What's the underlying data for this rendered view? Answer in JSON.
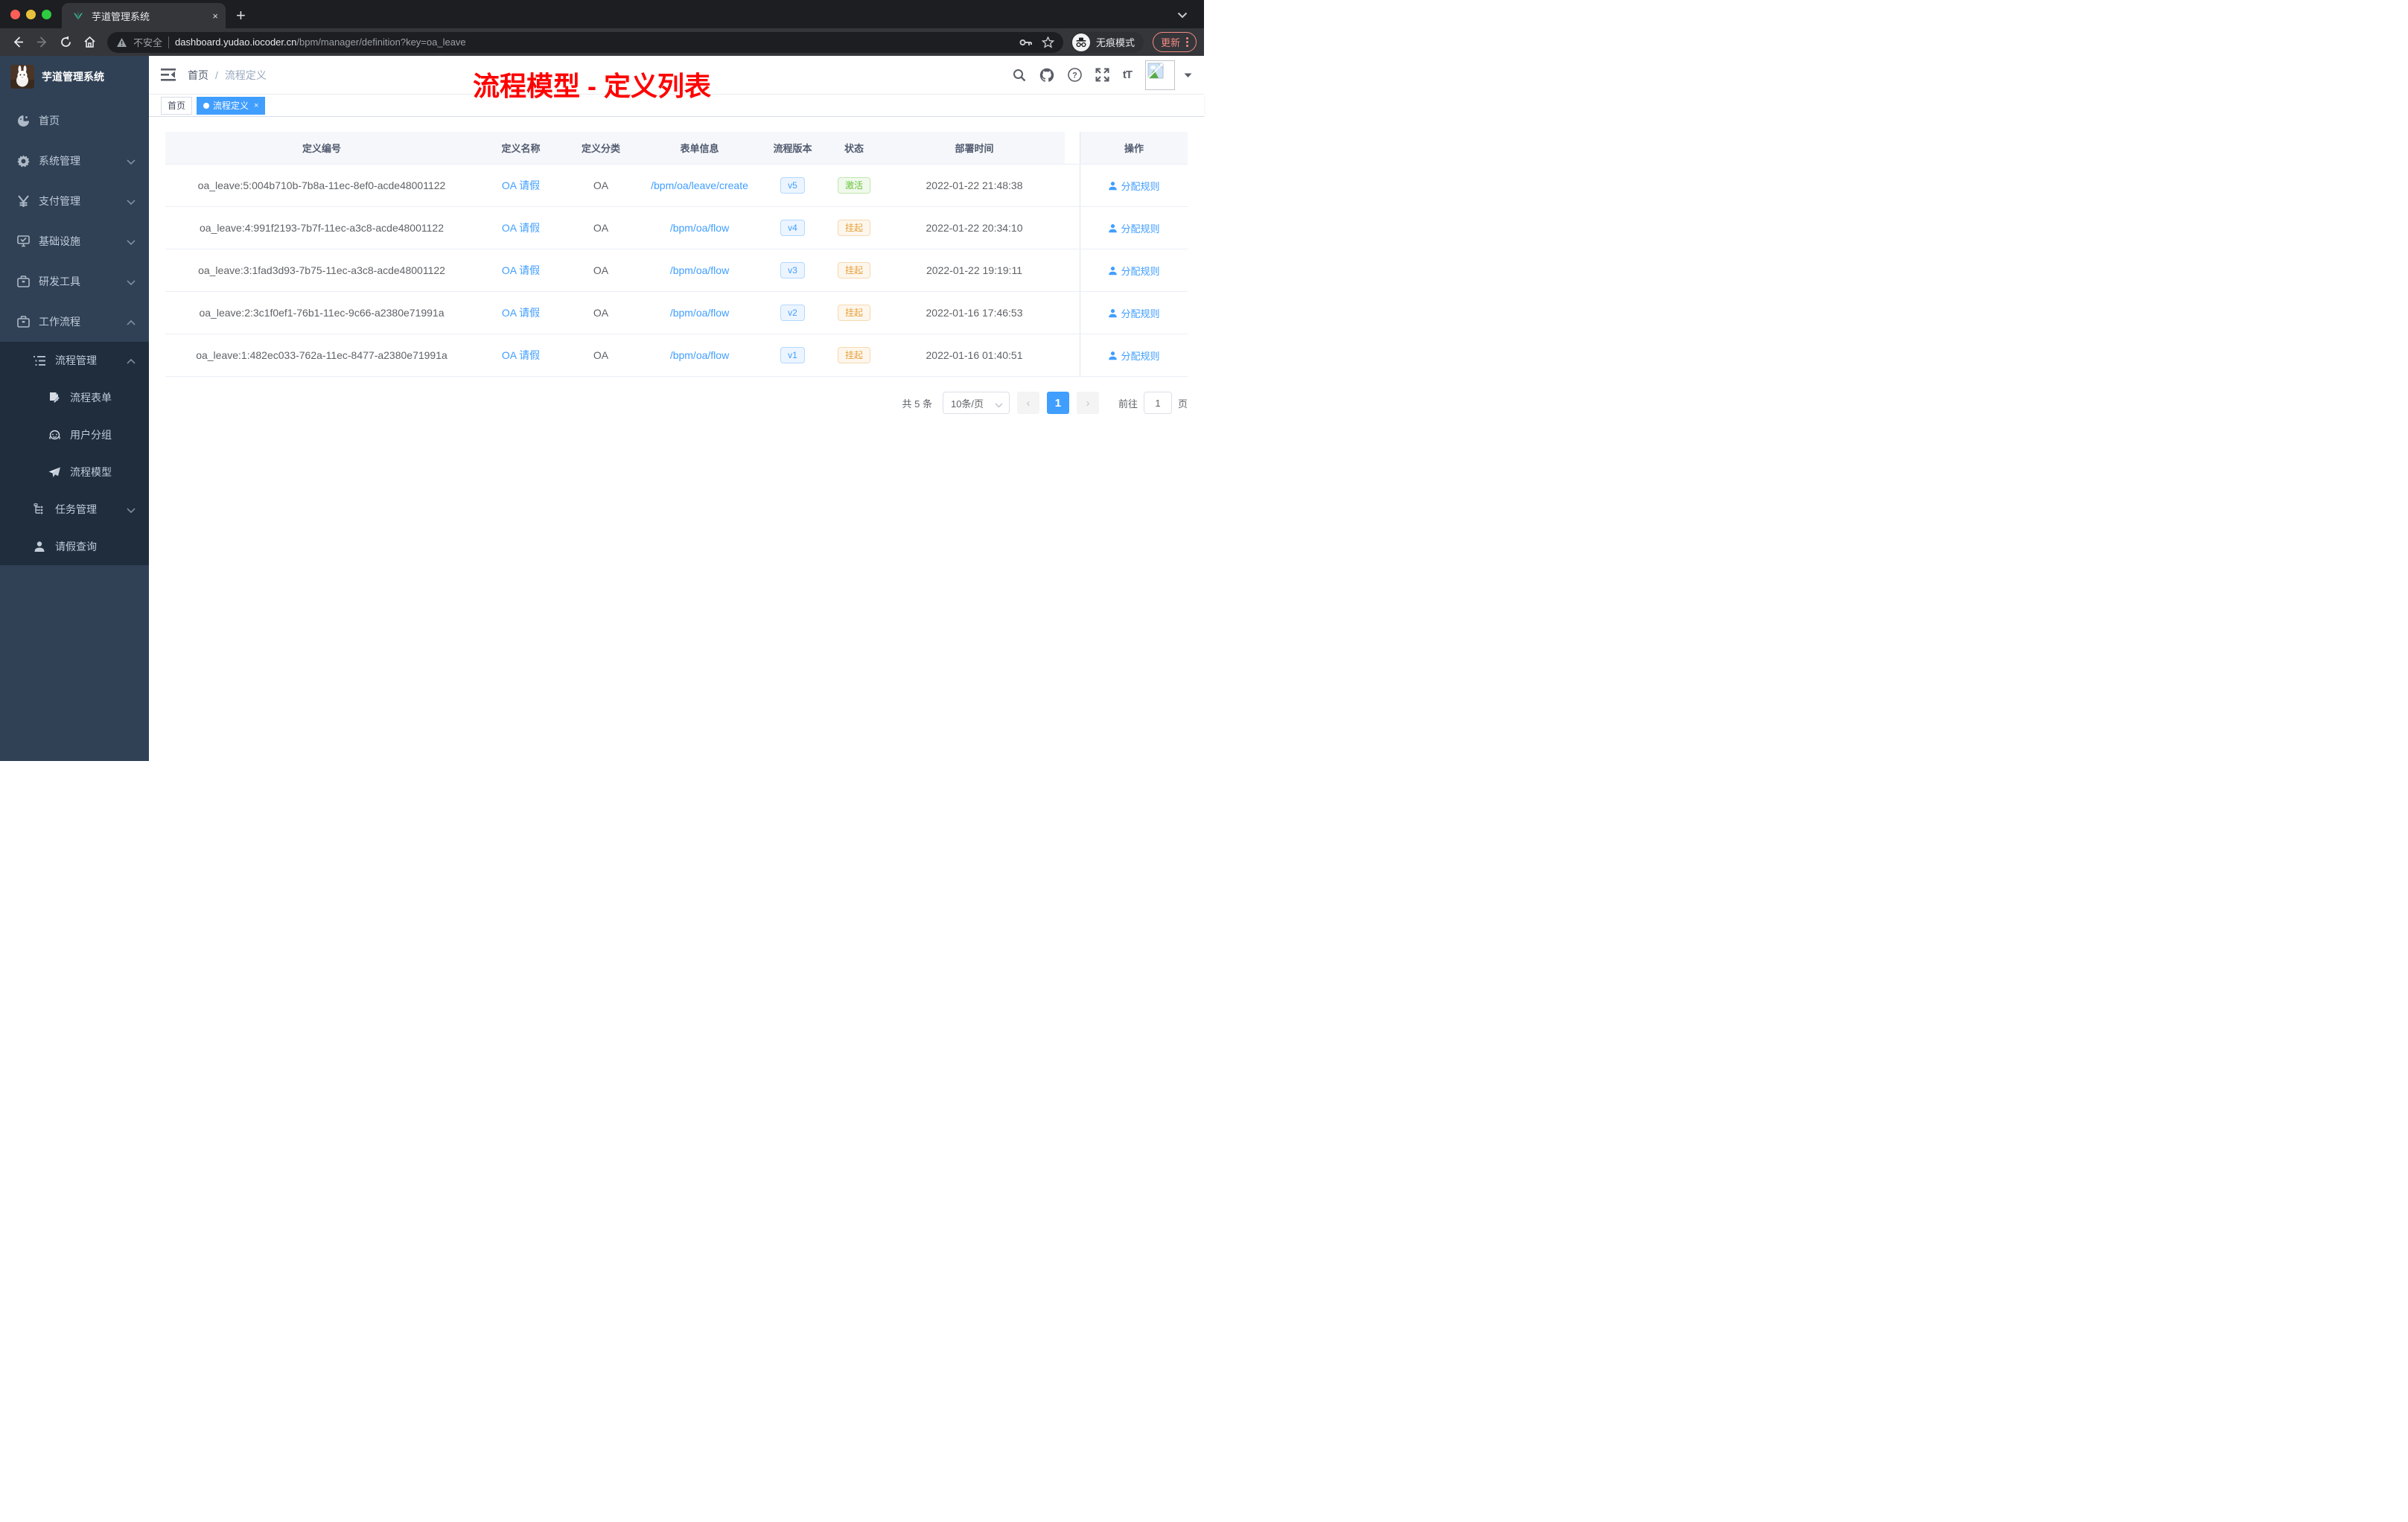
{
  "browser": {
    "tab_title": "芋道管理系统",
    "tab_close": "×",
    "security_label": "不安全",
    "url_domain": "dashboard.yudao.iocoder.cn",
    "url_path": "/bpm/manager/definition?key=oa_leave",
    "incognito_label": "无痕模式",
    "update_label": "更新"
  },
  "annotation": {
    "title": "流程模型 - 定义列表",
    "color": "#fe0100"
  },
  "sidebar": {
    "app_title": "芋道管理系统",
    "items": [
      {
        "label": "首页"
      },
      {
        "label": "系统管理"
      },
      {
        "label": "支付管理"
      },
      {
        "label": "基础设施"
      },
      {
        "label": "研发工具"
      },
      {
        "label": "工作流程"
      },
      {
        "label": "流程管理"
      },
      {
        "label": "流程表单"
      },
      {
        "label": "用户分组"
      },
      {
        "label": "流程模型"
      },
      {
        "label": "任务管理"
      },
      {
        "label": "请假查询"
      }
    ]
  },
  "navbar": {
    "breadcrumb_home": "首页",
    "breadcrumb_separator": "/",
    "breadcrumb_current": "流程定义"
  },
  "tags": {
    "home": "首页",
    "active": "流程定义",
    "close": "×"
  },
  "table": {
    "headers": [
      "定义编号",
      "定义名称",
      "定义分类",
      "表单信息",
      "流程版本",
      "状态",
      "部署时间",
      "操作"
    ],
    "action_label": "分配规则",
    "rows": [
      {
        "id": "oa_leave:5:004b710b-7b8a-11ec-8ef0-acde48001122",
        "name": "OA 请假",
        "category": "OA",
        "form": "/bpm/oa/leave/create",
        "version": "v5",
        "status": "激活",
        "status_type": "success",
        "time": "2022-01-22 21:48:38"
      },
      {
        "id": "oa_leave:4:991f2193-7b7f-11ec-a3c8-acde48001122",
        "name": "OA 请假",
        "category": "OA",
        "form": "/bpm/oa/flow",
        "version": "v4",
        "status": "挂起",
        "status_type": "warning",
        "time": "2022-01-22 20:34:10"
      },
      {
        "id": "oa_leave:3:1fad3d93-7b75-11ec-a3c8-acde48001122",
        "name": "OA 请假",
        "category": "OA",
        "form": "/bpm/oa/flow",
        "version": "v3",
        "status": "挂起",
        "status_type": "warning",
        "time": "2022-01-22 19:19:11"
      },
      {
        "id": "oa_leave:2:3c1f0ef1-76b1-11ec-9c66-a2380e71991a",
        "name": "OA 请假",
        "category": "OA",
        "form": "/bpm/oa/flow",
        "version": "v2",
        "status": "挂起",
        "status_type": "warning",
        "time": "2022-01-16 17:46:53"
      },
      {
        "id": "oa_leave:1:482ec033-762a-11ec-8477-a2380e71991a",
        "name": "OA 请假",
        "category": "OA",
        "form": "/bpm/oa/flow",
        "version": "v1",
        "status": "挂起",
        "status_type": "warning",
        "time": "2022-01-16 01:40:51"
      }
    ]
  },
  "pagination": {
    "total": "共 5 条",
    "page_size": "10条/页",
    "prev": "‹",
    "current_page": "1",
    "next": "›",
    "goto_label": "前往",
    "goto_value": "1",
    "page_unit": "页"
  },
  "colors": {
    "accent": "#409eff",
    "success": "#67c23a",
    "warning": "#e6a23c",
    "sidebar_bg": "#304156",
    "submenu_bg": "#1f2d3d",
    "annotation_red": "#fe0100"
  }
}
